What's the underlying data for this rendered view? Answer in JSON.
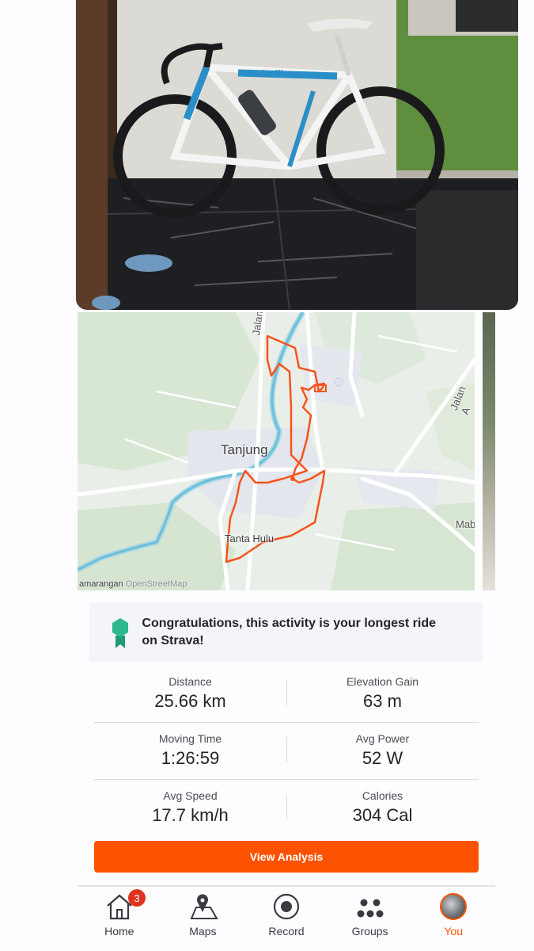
{
  "activity_photo": {
    "description_icon": "bicycle-photo",
    "brand_text": "Cinelli"
  },
  "map": {
    "labels": {
      "town": "Tanjung",
      "village": "Tanta Hulu",
      "road_north": "Jalan Basu",
      "road_east": "Jalan A",
      "east_edge": "Mab",
      "west_edge": "amarangan"
    },
    "attribution": "OpenStreetMap",
    "route_color": "#fc5200"
  },
  "achievement": {
    "icon": "medal-icon",
    "text": "Congratulations, this activity is your longest ride on Strava!"
  },
  "stats": [
    {
      "label": "Distance",
      "value": "25.66 km"
    },
    {
      "label": "Elevation Gain",
      "value": "63 m"
    },
    {
      "label": "Moving Time",
      "value": "1:26:59"
    },
    {
      "label": "Avg Power",
      "value": "52 W"
    },
    {
      "label": "Avg Speed",
      "value": "17.7 km/h"
    },
    {
      "label": "Calories",
      "value": "304 Cal"
    }
  ],
  "actions": {
    "view_analysis": "View Analysis"
  },
  "tabbar": {
    "home": {
      "label": "Home",
      "badge": "3",
      "icon": "home-icon"
    },
    "maps": {
      "label": "Maps",
      "icon": "map-pin-icon"
    },
    "record": {
      "label": "Record",
      "icon": "record-icon"
    },
    "groups": {
      "label": "Groups",
      "icon": "groups-icon"
    },
    "you": {
      "label": "You",
      "icon": "avatar",
      "active": true
    }
  },
  "colors": {
    "accent": "#fc5200",
    "badge": "#e0331f",
    "medal": "#2db88d"
  }
}
